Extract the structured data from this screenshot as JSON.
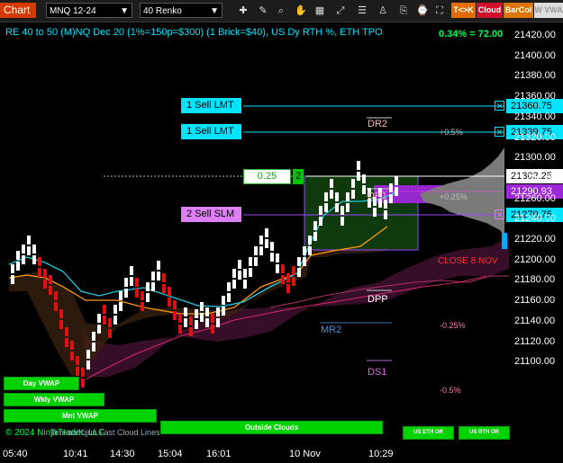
{
  "toolbar": {
    "chart_label": "Chart",
    "instrument": "MNQ 12-24",
    "bar_type": "40 Renko",
    "btn_tk": "T<>K",
    "btn_cloud": "Cloud",
    "btn_barcol": "BarCol",
    "btn_vwap": "W VWA"
  },
  "header": {
    "info": "RE 40 to 50 (M)NQ Dec 20 (1%=150p=$300) (1 Brick=$40), US Dy RTH %, ETH TPO",
    "pct_change": "0.34% = 72.00"
  },
  "orders": [
    {
      "label": "1 Sell LMT",
      "price": "21360.75"
    },
    {
      "label": "1 Sell LMT",
      "price": "21339.75"
    },
    {
      "label": "2 Sell SLM",
      "price": "21270.75"
    }
  ],
  "position": {
    "qty_box": "0.25",
    "qty_badge": "2",
    "last_price": "21303.25",
    "current_price": "21290.93"
  },
  "levels": {
    "dr2": "DR2",
    "dr1": "DR1",
    "dpp": "DPP",
    "mr2": "MR2",
    "ds1": "DS1",
    "pos_pct_0_5": "+0.5%",
    "pos_pct_0_25": "+0.25%",
    "neg_pct_0_25": "-0.25%",
    "neg_pct_0_5": "-0.5%",
    "close_label": "CLOSE 8 NOV"
  },
  "y_axis": [
    "21420.00",
    "21400.00",
    "21380.00",
    "21360.00",
    "21340.00",
    "21320.00",
    "21300.00",
    "21280.00",
    "21260.00",
    "21240.00",
    "21220.00",
    "21200.00",
    "21180.00",
    "21160.00",
    "21140.00",
    "21120.00",
    "21100.00"
  ],
  "x_axis": [
    "05:40",
    "10:41",
    "14:30",
    "15:04",
    "16:01",
    "10 Nov",
    "10:29"
  ],
  "status_bars": {
    "day_vwap": "Day VWAP",
    "wkly_vwap": "Wkly VWAP",
    "mnt_vwap": "Mnt VWAP",
    "outside_clouds": "Outside Clouds",
    "us_eth_or": "US ETH OR",
    "us_rth_or": "US RTH OR"
  },
  "footer": {
    "copyright": "© 2024 NinjaTrader, LLC",
    "indicator": "Tenkan/Kijun Fast Cloud Lines"
  },
  "colors": {
    "accent_cyan": "#00e5ff",
    "bull": "#ffffff",
    "bear": "#e01010",
    "cloud": "#3a0f2a",
    "status_green": "#00d200"
  }
}
